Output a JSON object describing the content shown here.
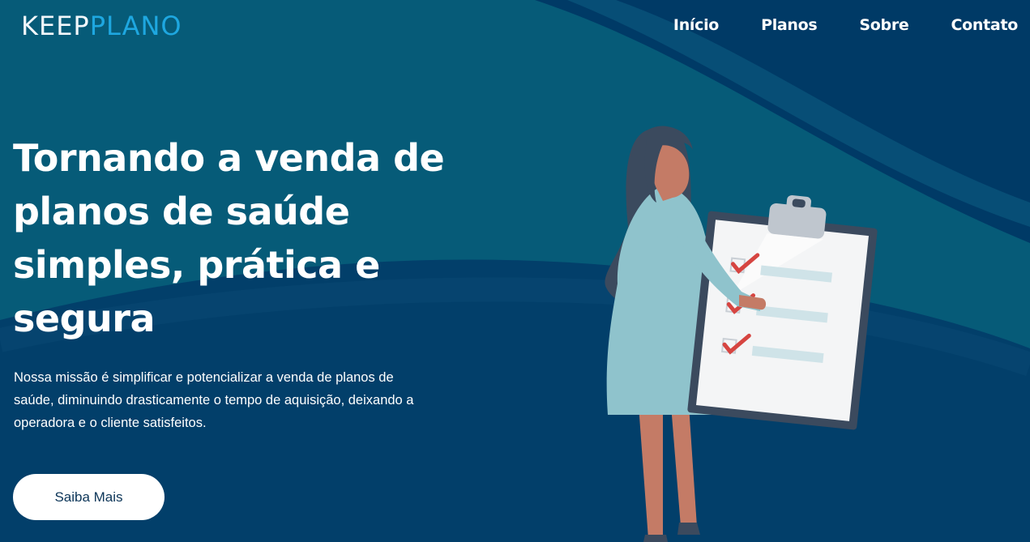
{
  "brand": {
    "logo_part1": "KEEP",
    "logo_part2": "LANO",
    "logo_initial2": "P"
  },
  "nav": {
    "items": [
      {
        "label": "Início"
      },
      {
        "label": "Planos"
      },
      {
        "label": "Sobre"
      },
      {
        "label": "Contato"
      }
    ]
  },
  "hero": {
    "title": "Tornando a venda de planos de saúde simples, prática e segura",
    "description": "Nossa missão é simplificar e potencializar a venda de planos de saúde, diminuindo drasticamente o tempo de aquisição, deixando a operadora e o cliente satisfeitos.",
    "cta_label": "Saiba Mais"
  },
  "colors": {
    "bg_dark": "#003a66",
    "bg_teal": "#065b78",
    "accent": "#1ea7e0",
    "check_red": "#d64541",
    "dress": "#8fc3cc",
    "skin": "#c47b66",
    "hair": "#3b4a5e"
  },
  "icons": {
    "logo": "keeplano-logo",
    "illustration": "woman-with-checklist-clipboard"
  }
}
